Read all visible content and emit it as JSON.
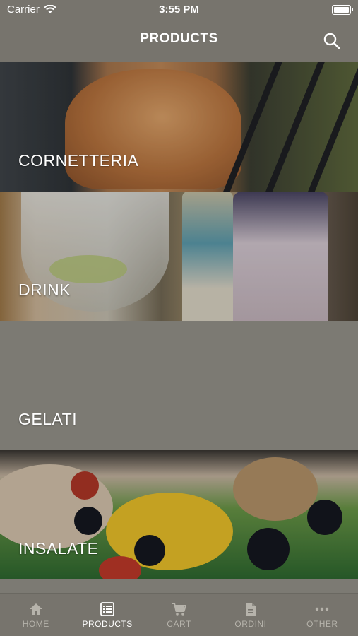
{
  "status_bar": {
    "carrier": "Carrier",
    "time": "3:55 PM"
  },
  "header": {
    "title": "PRODUCTS",
    "search_icon": "search-icon"
  },
  "categories": [
    {
      "label": "CORNETTERIA"
    },
    {
      "label": "DRINK"
    },
    {
      "label": "GELATI"
    },
    {
      "label": "INSALATE"
    }
  ],
  "tabs": [
    {
      "label": "HOME",
      "icon": "home-icon"
    },
    {
      "label": "PRODUCTS",
      "icon": "list-icon",
      "active": true
    },
    {
      "label": "CART",
      "icon": "cart-icon"
    },
    {
      "label": "ORDINI",
      "icon": "document-icon"
    },
    {
      "label": "OTHER",
      "icon": "more-icon"
    }
  ],
  "colors": {
    "bar": "#77746d",
    "active": "#ffffff",
    "inactive": "#b6b3ab"
  }
}
